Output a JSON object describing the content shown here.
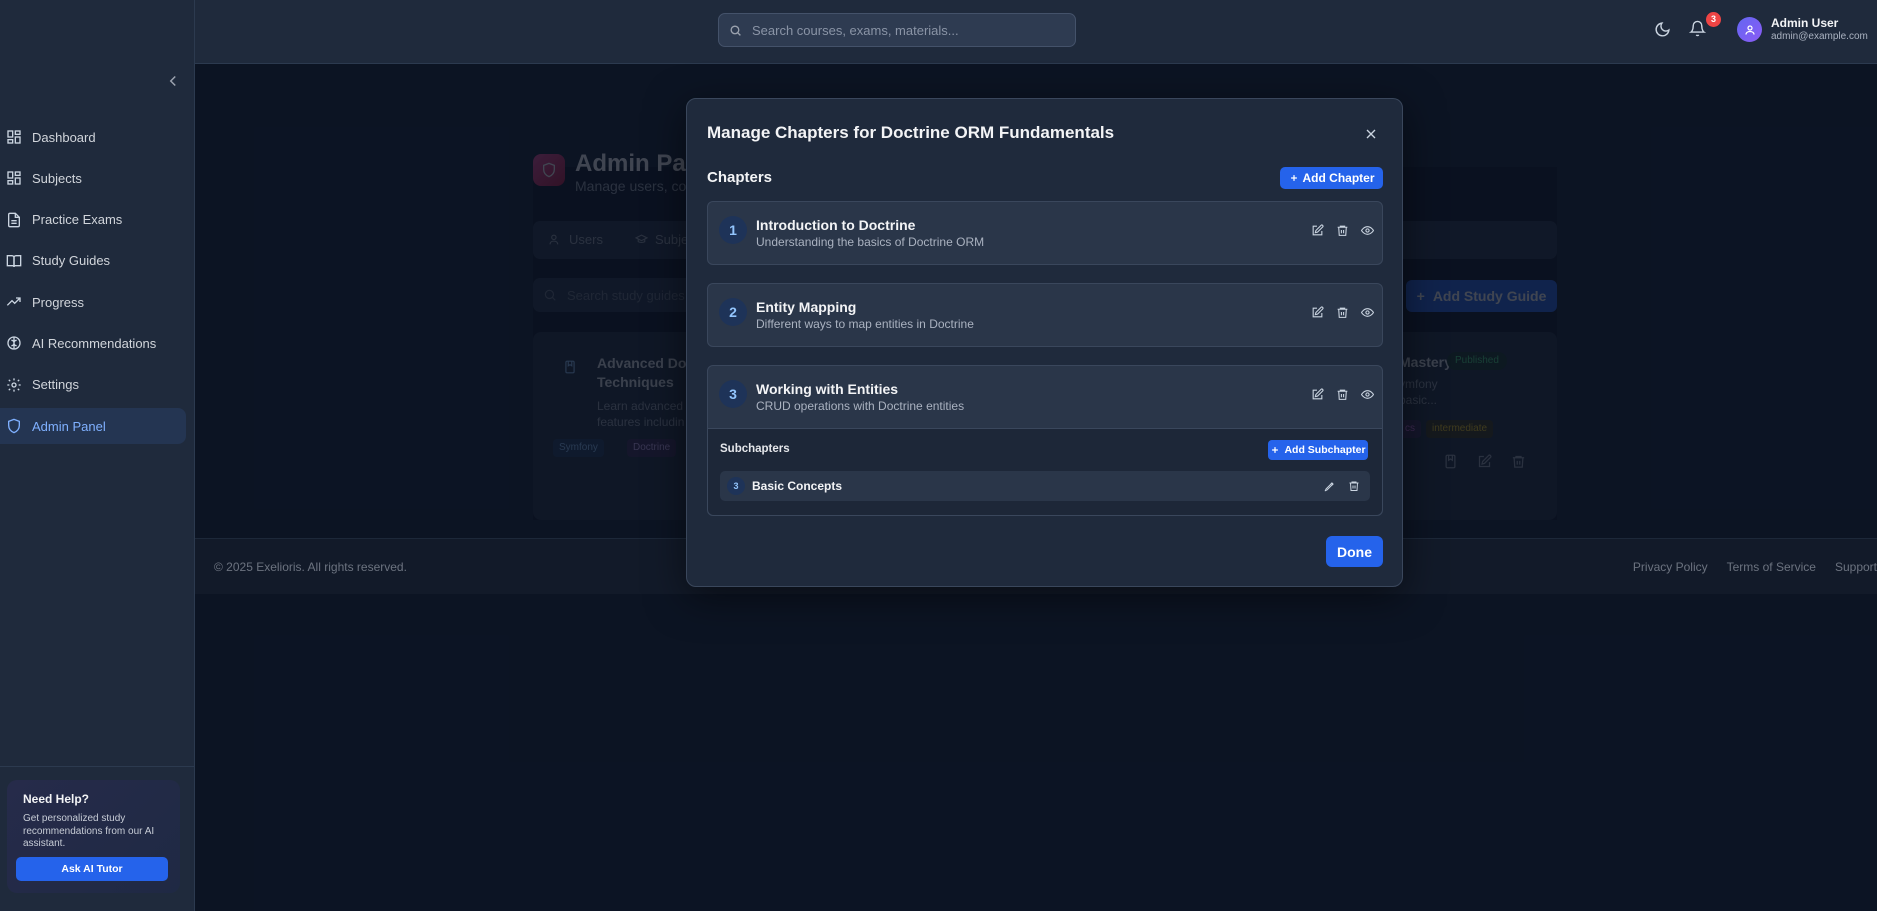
{
  "sidebar": {
    "items": [
      {
        "label": "Dashboard",
        "icon": "grid-icon"
      },
      {
        "label": "Subjects",
        "icon": "grid-icon"
      },
      {
        "label": "Practice Exams",
        "icon": "file-icon"
      },
      {
        "label": "Study Guides",
        "icon": "book-icon"
      },
      {
        "label": "Progress",
        "icon": "trend-icon"
      },
      {
        "label": "AI Recommendations",
        "icon": "brain-icon"
      },
      {
        "label": "Settings",
        "icon": "gear-icon"
      },
      {
        "label": "Admin Panel",
        "icon": "shield-icon",
        "active": true
      }
    ],
    "help": {
      "title": "Need Help?",
      "text": "Get personalized study recommendations from our AI assistant.",
      "button": "Ask AI Tutor"
    }
  },
  "header": {
    "search_placeholder": "Search courses, exams, materials...",
    "notification_count": "3",
    "user_name": "Admin User",
    "user_email": "admin@example.com"
  },
  "background": {
    "title": "Admin Pa",
    "subtitle": "Manage users, co",
    "tabs": [
      "Users",
      "Subje"
    ],
    "search_placeholder": "Search study guides",
    "add_button": "Add Study Guide",
    "card_left": {
      "title": "Advanced Doc Techniques",
      "desc": "Learn advanced features includin",
      "tags": [
        "Symfony",
        "Doctrine"
      ]
    },
    "card_right": {
      "title": "Mastery",
      "status": "Published",
      "desc": "ymfony basic...",
      "tags": [
        "cs",
        "intermediate"
      ]
    }
  },
  "modal": {
    "title": "Manage Chapters for Doctrine ORM Fundamentals",
    "chapters_heading": "Chapters",
    "add_chapter": "Add Chapter",
    "chapters": [
      {
        "num": "1",
        "title": "Introduction to Doctrine",
        "desc": "Understanding the basics of Doctrine ORM"
      },
      {
        "num": "2",
        "title": "Entity Mapping",
        "desc": "Different ways to map entities in Doctrine"
      },
      {
        "num": "3",
        "title": "Working with Entities",
        "desc": "CRUD operations with Doctrine entities"
      }
    ],
    "subchapters_heading": "Subchapters",
    "add_subchapter": "Add Subchapter",
    "subchapters": [
      {
        "num": "3",
        "title": "Basic Concepts"
      }
    ],
    "done": "Done"
  },
  "footer": {
    "copyright": "© 2025 Exelioris. All rights reserved.",
    "links": [
      "Privacy Policy",
      "Terms of Service",
      "Support"
    ]
  }
}
